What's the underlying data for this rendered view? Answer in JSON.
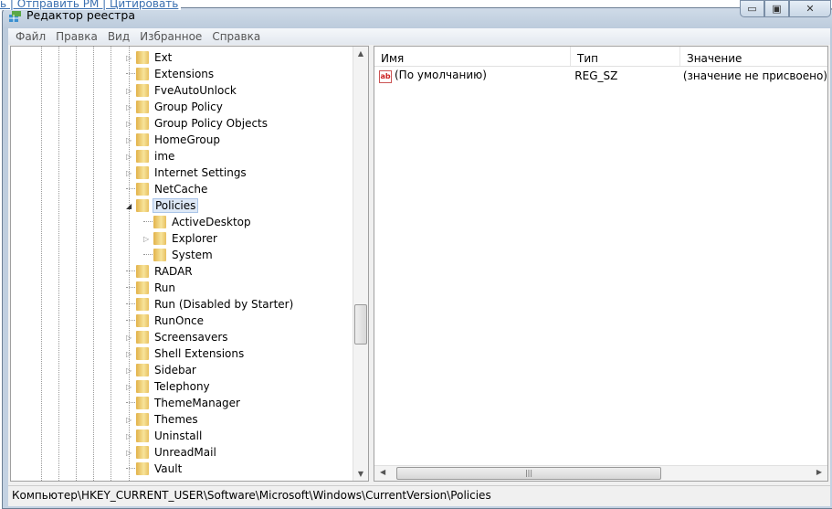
{
  "background_links": "ь | Отправить PM | Цитировать",
  "window": {
    "title": "Редактор реестра",
    "minimize": "▭",
    "maximize": "▣",
    "close": "✕"
  },
  "menu": [
    "Файл",
    "Правка",
    "Вид",
    "Избранное",
    "Справка"
  ],
  "tree": [
    {
      "label": "Ext",
      "expander": "collapsed",
      "level": 0
    },
    {
      "label": "Extensions",
      "expander": "none",
      "level": 0
    },
    {
      "label": "FveAutoUnlock",
      "expander": "collapsed",
      "level": 0
    },
    {
      "label": "Group Policy",
      "expander": "collapsed",
      "level": 0
    },
    {
      "label": "Group Policy Objects",
      "expander": "collapsed",
      "level": 0
    },
    {
      "label": "HomeGroup",
      "expander": "collapsed",
      "level": 0
    },
    {
      "label": "ime",
      "expander": "collapsed",
      "level": 0
    },
    {
      "label": "Internet Settings",
      "expander": "collapsed",
      "level": 0
    },
    {
      "label": "NetCache",
      "expander": "none",
      "level": 0
    },
    {
      "label": "Policies",
      "expander": "expanded",
      "level": 0,
      "selected": true
    },
    {
      "label": "ActiveDesktop",
      "expander": "none",
      "level": 1
    },
    {
      "label": "Explorer",
      "expander": "collapsed",
      "level": 1
    },
    {
      "label": "System",
      "expander": "none",
      "level": 1
    },
    {
      "label": "RADAR",
      "expander": "none",
      "level": 0
    },
    {
      "label": "Run",
      "expander": "none",
      "level": 0
    },
    {
      "label": "Run (Disabled by Starter)",
      "expander": "none",
      "level": 0
    },
    {
      "label": "RunOnce",
      "expander": "none",
      "level": 0
    },
    {
      "label": "Screensavers",
      "expander": "collapsed",
      "level": 0
    },
    {
      "label": "Shell Extensions",
      "expander": "collapsed",
      "level": 0
    },
    {
      "label": "Sidebar",
      "expander": "collapsed",
      "level": 0
    },
    {
      "label": "Telephony",
      "expander": "collapsed",
      "level": 0
    },
    {
      "label": "ThemeManager",
      "expander": "none",
      "level": 0
    },
    {
      "label": "Themes",
      "expander": "collapsed",
      "level": 0
    },
    {
      "label": "Uninstall",
      "expander": "collapsed",
      "level": 0
    },
    {
      "label": "UnreadMail",
      "expander": "collapsed",
      "level": 0
    },
    {
      "label": "Vault",
      "expander": "none",
      "level": 0
    }
  ],
  "list": {
    "columns": [
      "Имя",
      "Тип",
      "Значение"
    ],
    "rows": [
      {
        "name": "(По умолчанию)",
        "type": "REG_SZ",
        "value": "(значение не присвоено)",
        "icon": "ab"
      }
    ]
  },
  "status": "Компьютер\\HKEY_CURRENT_USER\\Software\\Microsoft\\Windows\\CurrentVersion\\Policies"
}
